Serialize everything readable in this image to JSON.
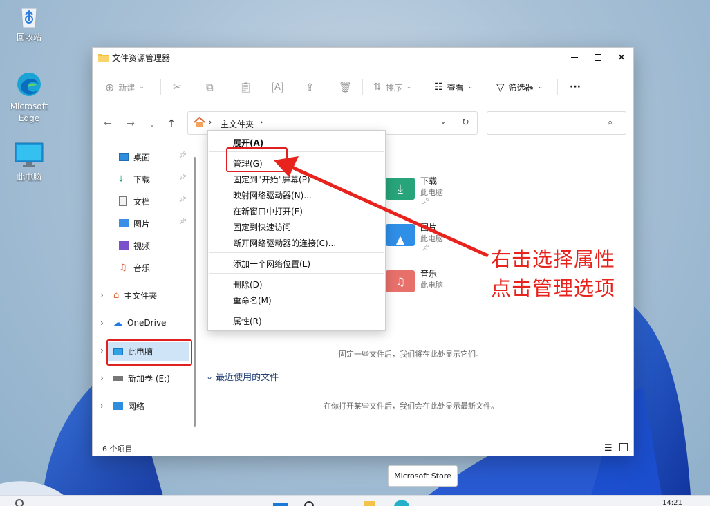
{
  "desktop": {
    "icons": [
      {
        "label": "回收站",
        "icon": "recycle-bin-icon"
      },
      {
        "label": "Microsoft Edge",
        "icon": "edge-icon"
      },
      {
        "label": "此电脑",
        "icon": "this-pc-icon"
      }
    ]
  },
  "window": {
    "title": "文件资源管理器",
    "toolbar": {
      "new_label": "新建",
      "sort_label": "排序",
      "view_label": "查看",
      "filter_label": "筛选器",
      "more_label": "···"
    },
    "breadcrumb": {
      "current": "主文件夹"
    },
    "search": {
      "placeholder": ""
    },
    "sidebar": {
      "quick": [
        {
          "label": "桌面",
          "icon": "desktop-icon"
        },
        {
          "label": "下载",
          "icon": "download-icon"
        },
        {
          "label": "文档",
          "icon": "document-icon"
        },
        {
          "label": "图片",
          "icon": "pictures-icon"
        },
        {
          "label": "视频",
          "icon": "video-icon"
        },
        {
          "label": "音乐",
          "icon": "music-icon"
        }
      ],
      "tree": [
        {
          "label": "主文件夹",
          "icon": "home-icon"
        },
        {
          "label": "OneDrive",
          "icon": "cloud-icon"
        },
        {
          "label": "此电脑",
          "icon": "this-pc-icon"
        },
        {
          "label": "新加卷 (E:)",
          "icon": "drive-icon"
        },
        {
          "label": "网络",
          "icon": "network-icon"
        }
      ]
    },
    "content": {
      "folders": [
        {
          "name": "下载",
          "sub": "此电脑"
        },
        {
          "name": "图片",
          "sub": "此电脑"
        },
        {
          "name": "音乐",
          "sub": "此电脑"
        }
      ],
      "pinned_hint": "固定一些文件后，我们将在此处显示它们。",
      "recent_title": "最近使用的文件",
      "recent_hint": "在你打开某些文件后，我们会在此处显示最新文件。"
    },
    "status": "6 个项目"
  },
  "context_menu": {
    "items": [
      "展开(A)",
      "管理(G)",
      "固定到\"开始\"屏幕(P)",
      "映射网络驱动器(N)...",
      "在新窗口中打开(E)",
      "固定到快速访问",
      "断开网络驱动器的连接(C)...",
      "添加一个网络位置(L)",
      "删除(D)",
      "重命名(M)",
      "属性(R)"
    ]
  },
  "annotation": {
    "line1": "右击选择属性",
    "line2": "点击管理选项"
  },
  "store_tooltip": "Microsoft Store",
  "clock": "14:21",
  "colors": {
    "highlight": "#e02020",
    "selection": "#cfe4f7",
    "accent": "#0067c0"
  }
}
